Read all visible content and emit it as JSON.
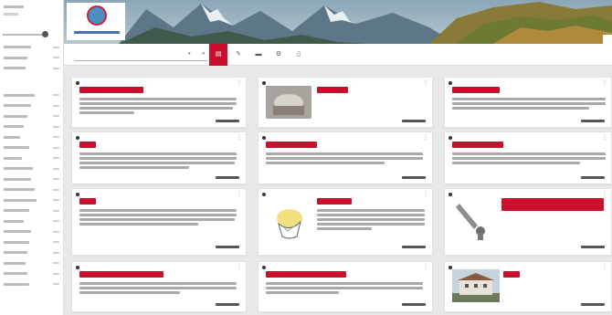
{
  "app": {
    "title": "",
    "logo_caption": ""
  },
  "colors": {
    "accent": "#c8102e",
    "page_background": "#e8e8ea",
    "card_background": "#ffffff",
    "logo_ring": "#c0283a",
    "logo_fill": "#4b8ec1"
  },
  "sidebar": {
    "groups": [
      3,
      19
    ],
    "icons": [
      "slider-handle-icon"
    ]
  },
  "toolbar": {
    "search_value": "",
    "search_placeholder": "",
    "search_dropdown_icon": "chevron-down-icon",
    "buttons": [
      {
        "name": "button-1",
        "icon": "document-icon",
        "label": "",
        "active": true
      },
      {
        "name": "button-2",
        "icon": "pen-icon",
        "label": "",
        "active": false
      },
      {
        "name": "button-3",
        "icon": "folder-icon",
        "label": "",
        "active": false
      },
      {
        "name": "button-4",
        "icon": "gear-icon",
        "label": "",
        "active": false
      },
      {
        "name": "button-5",
        "icon": "page-icon",
        "label": "",
        "active": false
      }
    ]
  },
  "cards": [
    {
      "id": "card-1",
      "has_image": false,
      "tag": "",
      "lines": 4,
      "date": ""
    },
    {
      "id": "card-2",
      "has_image": true,
      "image_kind": "photo",
      "tag": "",
      "lines": 0,
      "date": ""
    },
    {
      "id": "card-3",
      "has_image": false,
      "tag": "",
      "lines": 3,
      "date": ""
    },
    {
      "id": "card-4",
      "has_image": false,
      "tag": "",
      "lines": 4,
      "date": ""
    },
    {
      "id": "card-5",
      "has_image": false,
      "tag": "",
      "lines": 3,
      "date": ""
    },
    {
      "id": "card-6",
      "has_image": false,
      "tag": "",
      "lines": 3,
      "date": ""
    },
    {
      "id": "card-7",
      "has_image": false,
      "tag": "",
      "lines": 4,
      "date": ""
    },
    {
      "id": "card-8",
      "has_image": true,
      "image_kind": "drawing",
      "tag": "",
      "lines": 5,
      "date": ""
    },
    {
      "id": "card-9",
      "has_image": true,
      "image_kind": "tool",
      "tag": "",
      "lines": 0,
      "date": ""
    },
    {
      "id": "card-10",
      "has_image": false,
      "tag": "",
      "lines": 3,
      "date": ""
    },
    {
      "id": "card-11",
      "has_image": false,
      "tag": "",
      "lines": 3,
      "date": ""
    },
    {
      "id": "card-12",
      "has_image": true,
      "image_kind": "building",
      "tag": "",
      "lines": 0,
      "date": ""
    }
  ]
}
